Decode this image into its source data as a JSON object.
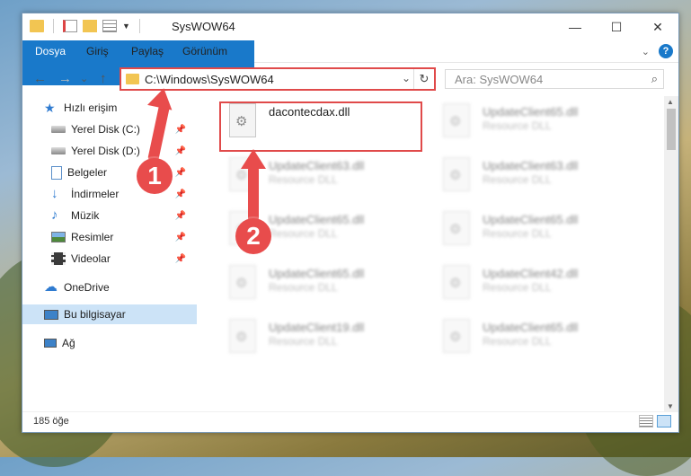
{
  "window": {
    "title": "SysWOW64",
    "controls": {
      "minimize": "—",
      "maximize": "☐",
      "close": "✕"
    }
  },
  "ribbon": {
    "tabs": [
      "Dosya",
      "Giriş",
      "Paylaş",
      "Görünüm"
    ],
    "collapse_icon": "chevron-down-icon",
    "help": "?"
  },
  "nav": {
    "back": "←",
    "forward": "→",
    "recent": "⌄",
    "up": "↑",
    "address": "C:\\Windows\\SysWOW64",
    "address_dropdown": "⌄",
    "refresh": "↻",
    "search_placeholder": "Ara: SysWOW64",
    "search_icon": "⌕"
  },
  "sidebar": {
    "items": [
      {
        "label": "Hızlı erişim",
        "icon": "star-icon"
      },
      {
        "label": "Yerel Disk (C:)",
        "icon": "drive-icon",
        "pinned": true
      },
      {
        "label": "Yerel Disk (D:)",
        "icon": "drive-icon",
        "pinned": true
      },
      {
        "label": "Belgeler",
        "icon": "document-icon",
        "pinned": true
      },
      {
        "label": "İndirmeler",
        "icon": "download-icon",
        "pinned": true
      },
      {
        "label": "Müzik",
        "icon": "music-icon",
        "pinned": true
      },
      {
        "label": "Resimler",
        "icon": "picture-icon",
        "pinned": true
      },
      {
        "label": "Videolar",
        "icon": "video-icon",
        "pinned": true
      },
      {
        "label": "OneDrive",
        "icon": "cloud-icon"
      },
      {
        "label": "Bu bilgisayar",
        "icon": "computer-icon",
        "selected": true
      },
      {
        "label": "Ağ",
        "icon": "network-icon"
      }
    ]
  },
  "files": [
    {
      "name": "dacontecdax.dll",
      "type": ""
    },
    {
      "name": "UpdateClient65.dll",
      "type": "Resource DLL"
    },
    {
      "name": "UpdateClient63.dll",
      "type": "Resource DLL"
    },
    {
      "name": "UpdateClient63.dll",
      "type": "Resource DLL"
    },
    {
      "name": "UpdateClient65.dll",
      "type": "Resource DLL"
    },
    {
      "name": "UpdateClient65.dll",
      "type": "Resource DLL"
    },
    {
      "name": "UpdateClient65.dll",
      "type": "Resource DLL"
    },
    {
      "name": "UpdateClient42.dll",
      "type": "Resource DLL"
    },
    {
      "name": "UpdateClient19.dll",
      "type": "Resource DLL"
    },
    {
      "name": "UpdateClient65.dll",
      "type": "Resource DLL"
    }
  ],
  "status": {
    "count": "185 öğe"
  },
  "callouts": [
    "1",
    "2"
  ],
  "colors": {
    "accent": "#1979ca",
    "highlight": "#e04a4a",
    "callout": "#e84c4c",
    "selected": "#cce3f7"
  }
}
